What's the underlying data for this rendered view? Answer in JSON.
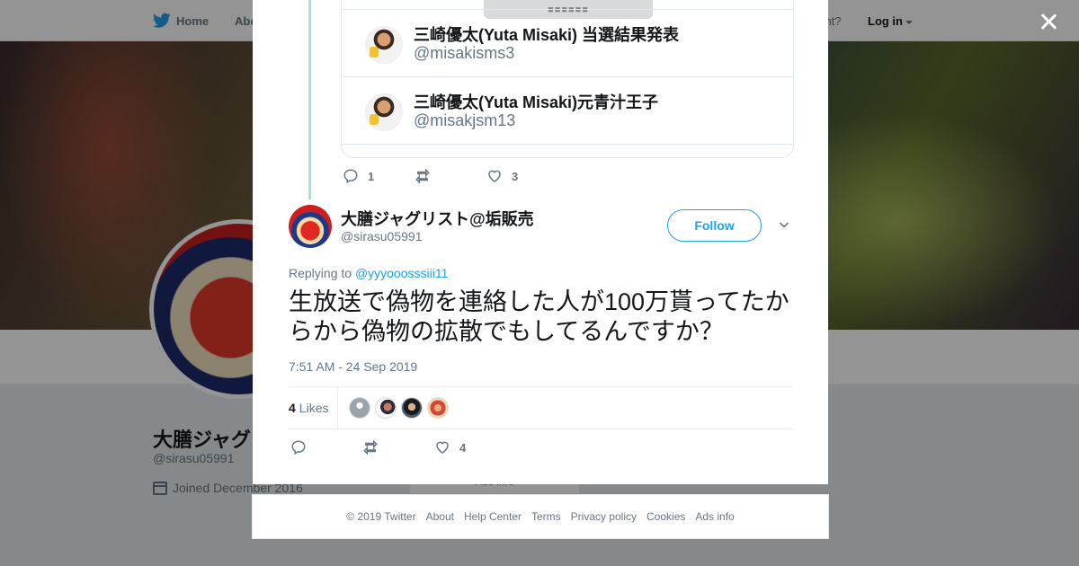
{
  "nav": {
    "home_label": "Home",
    "about_label": "Abo",
    "account_prompt": "ccount?",
    "login_label": "Log in"
  },
  "profile": {
    "name": "大膳ジャグ",
    "handle": "@sirasu05991",
    "joined": "Joined December 2016",
    "ads_info": "Ads info"
  },
  "previous_tweet": {
    "card_top_text": "■■■■■■",
    "card_items": [
      {
        "name": "三崎優太(Yuta Misaki) 当選結果発表",
        "handle": "@misakisms3"
      },
      {
        "name": "三崎優太(Yuta Misaki)元青汁王子",
        "handle": "@misakjsm13"
      }
    ],
    "reply_count": "1",
    "retweet_count": "",
    "like_count": "3"
  },
  "tweet": {
    "author_name": "大膳ジャグリスト@垢販売",
    "author_handle": "@sirasu05991",
    "follow_label": "Follow",
    "replying_prefix": "Replying to",
    "replying_to": "@yyyooosssiii11",
    "text": "生放送で偽物を連絡した人が100万貰ってたからから偽物の拡散でもしてるんですか？",
    "timestamp": "7:51 AM - 24 Sep 2019",
    "likes_count": "4",
    "likes_label": "Likes",
    "like_count_action": "4"
  },
  "footer": {
    "copyright": "© 2019 Twitter",
    "links": [
      "About",
      "Help Center",
      "Terms",
      "Privacy policy",
      "Cookies",
      "Ads info"
    ]
  },
  "colors": {
    "accent": "#1da1f2",
    "thread_line": "#a7dcf6",
    "secondary_text": "#657786"
  }
}
